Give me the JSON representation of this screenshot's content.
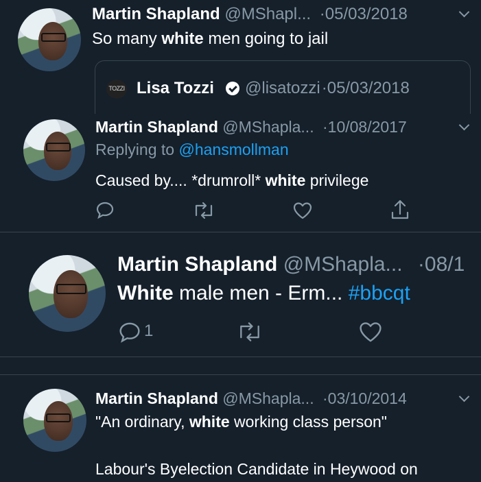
{
  "tweet1": {
    "name": "Martin Shapland",
    "handle": "@MShapl...",
    "sep": "·",
    "date": "05/03/2018",
    "text_before": "So many ",
    "text_bold": "white",
    "text_after": " men going to jail",
    "quote": {
      "avatar_text": "TOZZI",
      "name": "Lisa Tozzi",
      "handle": "@lisatozzi",
      "sep": "·",
      "date": "05/03/2018"
    }
  },
  "tweet2": {
    "name": "Martin Shapland",
    "handle": "@MShapla...",
    "sep": "·",
    "date": "10/08/2017",
    "reply_prefix": "Replying to ",
    "reply_handle": "@hansmollman",
    "text_before": "Caused by.... *drumroll* ",
    "text_bold": "white",
    "text_after": " privilege"
  },
  "tweet3": {
    "name": "Martin Shapland",
    "handle": "@MShapla...",
    "sep": "·",
    "date": "08/1",
    "text_bold": "White",
    "text_after": " male men - Erm... ",
    "hashtag": "#bbcqt",
    "reply_count": "1"
  },
  "tweet4": {
    "name": "Martin Shapland",
    "handle": "@MShapla...",
    "sep": "·",
    "date": "03/10/2014",
    "text_before": "\"An ordinary, ",
    "text_bold": "white",
    "text_after": " working class person\"",
    "text_line2": "Labour's Byelection Candidate in Heywood on"
  },
  "icons": [
    "reply-icon",
    "retweet-icon",
    "like-icon",
    "share-icon",
    "chevron-down-icon",
    "verified-badge-icon"
  ],
  "colors": {
    "background": "#15202b",
    "link": "#1da1f2",
    "muted": "#8899a6",
    "divider": "#38444d"
  }
}
